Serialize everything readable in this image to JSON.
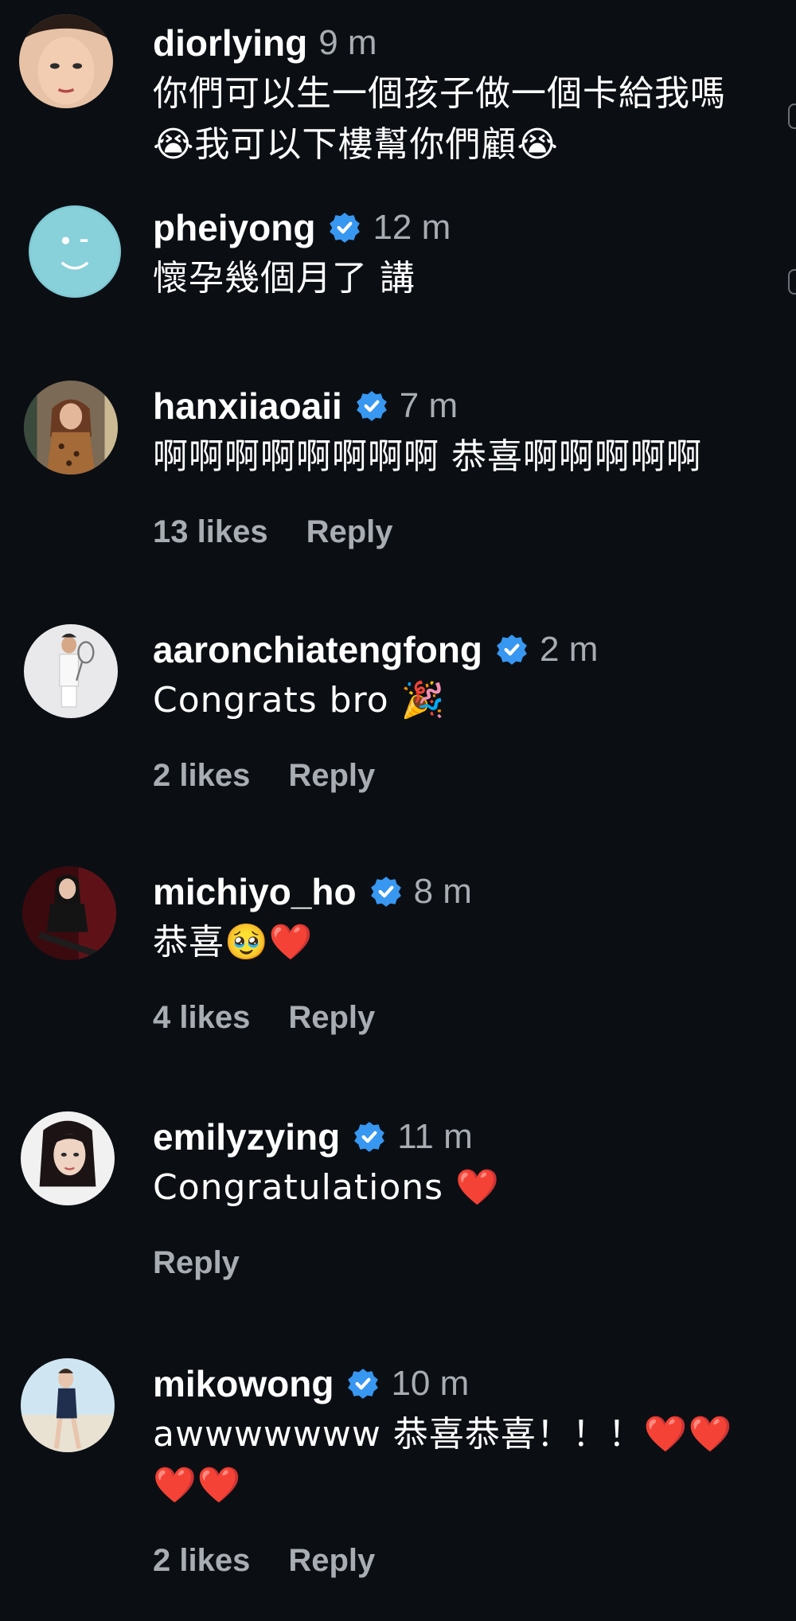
{
  "comments": [
    {
      "username": "diorlying",
      "verified": false,
      "time": "9 m",
      "text_lines": [
        "你們可以生一個孩子做一個卡給我嗎",
        "😭我可以下樓幫你們顧😭"
      ],
      "likes": "",
      "reply": ""
    },
    {
      "username": "pheiyong",
      "verified": true,
      "time": "12 m",
      "text_lines": [
        "懷孕幾個月了 講"
      ],
      "likes": "",
      "reply": ""
    },
    {
      "username": "hanxiiaoaii",
      "verified": true,
      "time": "7 m",
      "text_lines": [
        "啊啊啊啊啊啊啊啊 恭喜啊啊啊啊啊"
      ],
      "likes": "13 likes",
      "reply": "Reply"
    },
    {
      "username": "aaronchiatengfong",
      "verified": true,
      "time": "2 m",
      "text_lines": [
        "Congrats bro 🎉"
      ],
      "likes": "2 likes",
      "reply": "Reply"
    },
    {
      "username": "michiyo_ho",
      "verified": true,
      "time": "8 m",
      "text_lines": [
        "恭喜🥹❤️"
      ],
      "likes": "4 likes",
      "reply": "Reply"
    },
    {
      "username": "emilyzying",
      "verified": true,
      "time": "11 m",
      "text_lines": [
        "Congratulations ❤️"
      ],
      "likes": "",
      "reply": "Reply"
    },
    {
      "username": "mikowong",
      "verified": true,
      "time": "10 m",
      "text_lines": [
        "awwwwwww 恭喜恭喜！！！❤️❤️",
        "❤️❤️"
      ],
      "likes": "2 likes",
      "reply": "Reply"
    }
  ],
  "colors": {
    "background": "#0b0f14",
    "username": "#ffffff",
    "secondary": "#a8adb3",
    "verified": "#3897f0"
  },
  "icons": {
    "verified": "verified-badge-icon"
  }
}
